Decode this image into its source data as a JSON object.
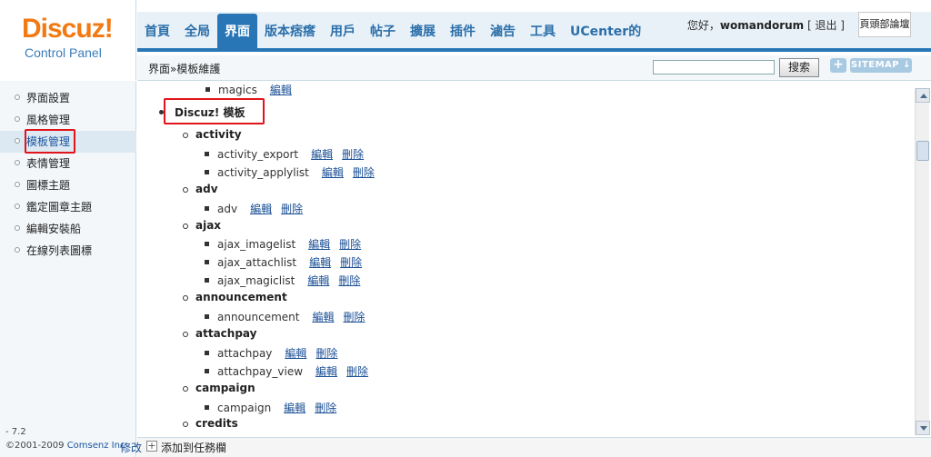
{
  "logo": {
    "name": "Discuz!",
    "sub": "Control Panel"
  },
  "nav": {
    "tabs": [
      "首頁",
      "全局",
      "界面",
      "版本痞瘩",
      "用戶",
      "帖子",
      "擴展",
      "插件",
      "滷告",
      "工具",
      "UCenter的"
    ],
    "active_tab": "界面"
  },
  "user": {
    "greeting": "您好，",
    "username": "womandorum",
    "logout": "[ 退出 ]",
    "head_box": "頁頭部論壇"
  },
  "breadcrumb": {
    "part1": "界面",
    "sep": "»",
    "part2": "模板維護"
  },
  "search": {
    "placeholder": "",
    "button": "搜索"
  },
  "sitemap": {
    "plus": "+",
    "label": "SITEMAP ↓"
  },
  "sidebar": {
    "items": [
      "界面設置",
      "風格管理",
      "模板管理",
      "表情管理",
      "圖標主題",
      "鑑定圖章主題",
      "編輯安裝船",
      "在線列表圖標"
    ],
    "active_index": 2,
    "version": "- 7.2",
    "copyright": "©2001-2009 ",
    "company": "Comsenz Inc"
  },
  "content": {
    "top_item": {
      "name": "magics",
      "edit": "編輯"
    },
    "root": "Discuz! 模板",
    "edit_label": "編輯",
    "delete_label": "刪除",
    "sections": [
      {
        "name": "activity",
        "items": [
          "activity_export",
          "activity_applylist"
        ]
      },
      {
        "name": "adv",
        "items": [
          "adv"
        ]
      },
      {
        "name": "ajax",
        "items": [
          "ajax_imagelist",
          "ajax_attachlist",
          "ajax_magiclist"
        ]
      },
      {
        "name": "announcement",
        "items": [
          "announcement"
        ]
      },
      {
        "name": "attachpay",
        "items": [
          "attachpay",
          "attachpay_view"
        ]
      },
      {
        "name": "campaign",
        "items": [
          "campaign"
        ]
      },
      {
        "name": "credits",
        "items": []
      }
    ]
  },
  "bottom": {
    "edit": "修改",
    "add": "+",
    "add_label": "添加到任務欄"
  }
}
